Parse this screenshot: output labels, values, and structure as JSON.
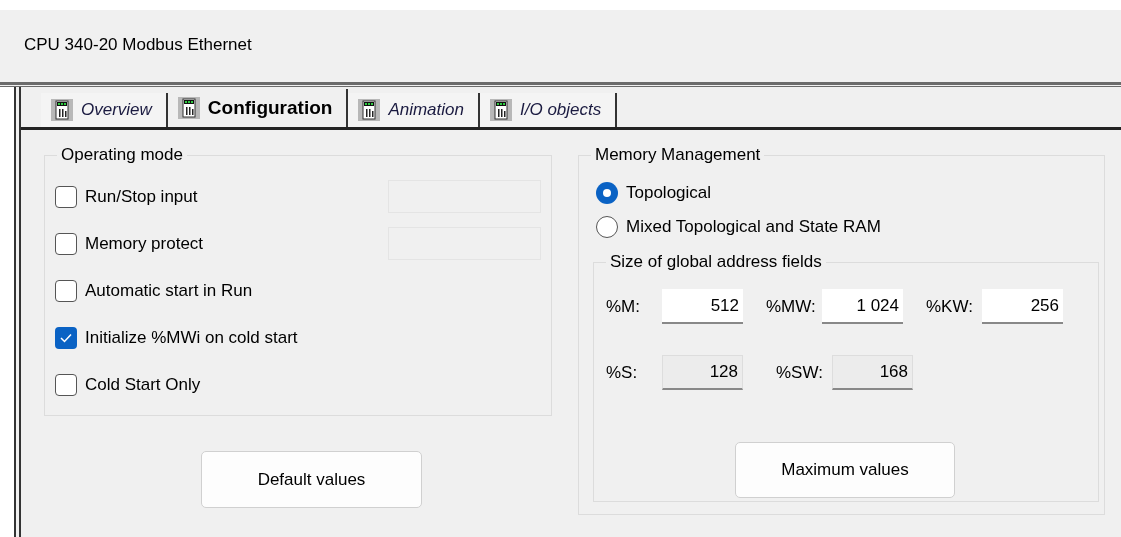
{
  "window": {
    "title": "CPU 340-20 Modbus Ethernet"
  },
  "tabs": [
    {
      "label": "Overview",
      "selected": false
    },
    {
      "label": "Configuration",
      "selected": true
    },
    {
      "label": "Animation",
      "selected": false
    },
    {
      "label": "I/O objects",
      "selected": false
    }
  ],
  "operating_mode": {
    "title": "Operating mode",
    "options": [
      {
        "label": "Run/Stop input",
        "checked": false,
        "kind": "with-field"
      },
      {
        "label": "Memory protect",
        "checked": false,
        "kind": "with-field"
      },
      {
        "label": "Automatic start in Run",
        "checked": false,
        "kind": "plain"
      },
      {
        "label": "Initialize %MWi on cold start",
        "checked": true,
        "kind": "plain"
      },
      {
        "label": "Cold Start Only",
        "checked": false,
        "kind": "plain"
      }
    ],
    "button": "Default values"
  },
  "memory_management": {
    "title": "Memory Management",
    "options": [
      {
        "label": "Topological",
        "selected": true
      },
      {
        "label": "Mixed Topological and State RAM",
        "selected": false
      }
    ],
    "address_fields": {
      "title": "Size of global address fields",
      "rows": [
        [
          {
            "label": "%M:",
            "value": "512",
            "disabled": false
          },
          {
            "label": "%MW:",
            "value": "1 024",
            "disabled": false
          },
          {
            "label": "%KW:",
            "value": "256",
            "disabled": false
          }
        ],
        [
          {
            "label": "%S:",
            "value": "128",
            "disabled": true
          },
          {
            "label": "%SW:",
            "value": "168",
            "disabled": true
          }
        ]
      ]
    },
    "button": "Maximum values"
  }
}
